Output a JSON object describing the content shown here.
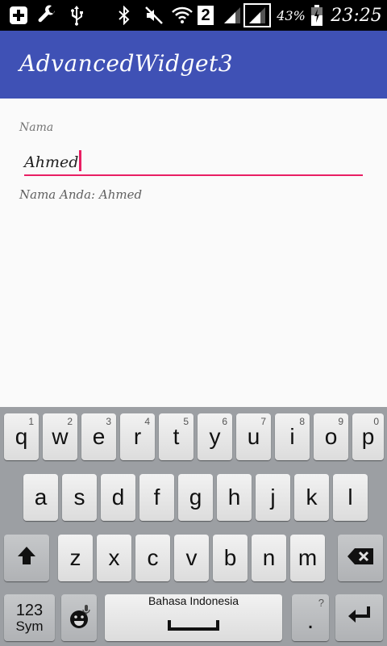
{
  "status_bar": {
    "sim_label": "2",
    "battery_percent": "43%",
    "time": "23:25",
    "icons": [
      "add-icon",
      "wrench-icon",
      "usb-icon",
      "bluetooth-icon",
      "mute-icon",
      "wifi-icon",
      "sim-icon",
      "signal-icon",
      "signal-icon",
      "battery-icon"
    ]
  },
  "app_bar": {
    "title": "AdvancedWidget3"
  },
  "form": {
    "label": "Nama",
    "input_value": "Ahmed",
    "result_text": "Nama Anda: Ahmed",
    "accent_color": "#e91e63"
  },
  "keyboard": {
    "row1": [
      {
        "key": "q",
        "hint": "1"
      },
      {
        "key": "w",
        "hint": "2"
      },
      {
        "key": "e",
        "hint": "3"
      },
      {
        "key": "r",
        "hint": "4"
      },
      {
        "key": "t",
        "hint": "5"
      },
      {
        "key": "y",
        "hint": "6"
      },
      {
        "key": "u",
        "hint": "7"
      },
      {
        "key": "i",
        "hint": "8"
      },
      {
        "key": "o",
        "hint": "9"
      },
      {
        "key": "p",
        "hint": "0"
      }
    ],
    "row2": [
      "a",
      "s",
      "d",
      "f",
      "g",
      "h",
      "j",
      "k",
      "l"
    ],
    "row3": [
      "z",
      "x",
      "c",
      "v",
      "b",
      "n",
      "m"
    ],
    "sym_label_top": "123",
    "sym_label_bottom": "Sym",
    "space_label": "Bahasa Indonesia",
    "period_label": ".",
    "period_hint": "?"
  },
  "colors": {
    "app_bar": "#3f51b5",
    "status_bar": "#000000",
    "keyboard_bg": "#9c9fa3"
  }
}
